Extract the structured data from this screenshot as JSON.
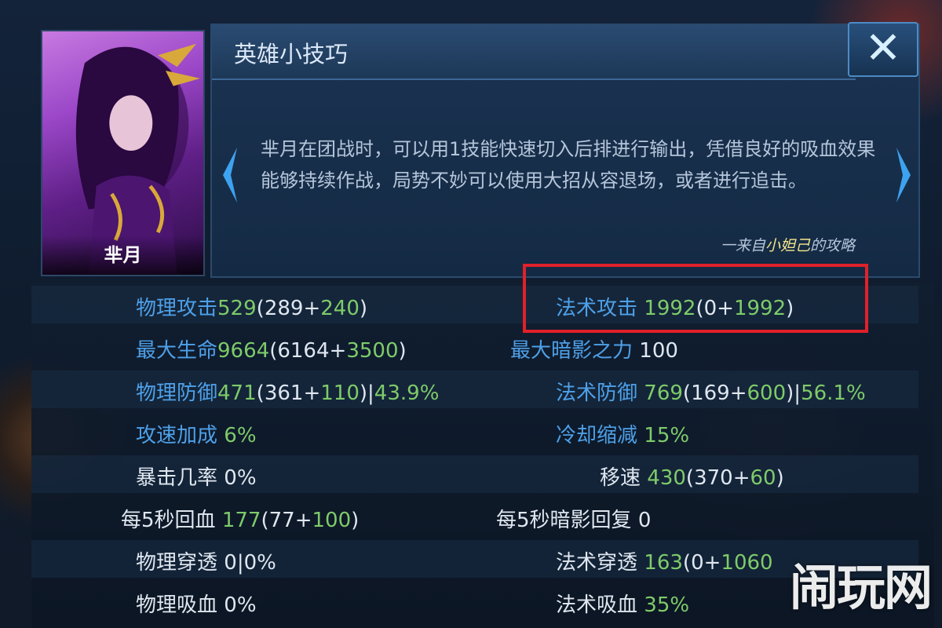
{
  "hero": {
    "name": "芈月"
  },
  "tip": {
    "title": "英雄小技巧",
    "body": "芈月在团战时，可以用1技能快速切入后排进行输出，凭借良好的吸血效果能够持续作战，局势不妙可以使用大招从容退场，或者进行追击。",
    "source_prefix": "一来自",
    "source_author": "小妲己",
    "source_suffix": "的攻略"
  },
  "close_symbol": "✕",
  "stats_left": [
    {
      "label": "物理攻击",
      "total": "529",
      "base": "289",
      "bonus": "240",
      "extra": ""
    },
    {
      "label": "最大生命",
      "total": "9664",
      "base": "6164",
      "bonus": "3500",
      "extra": ""
    },
    {
      "label": "物理防御",
      "total": "471",
      "base": "361",
      "bonus": "110",
      "extra": "43.9%"
    },
    {
      "label": "攻速加成",
      "total": "6%"
    },
    {
      "label": "暴击几率",
      "total": "0%"
    },
    {
      "label": "每5秒回血",
      "total": "177",
      "base": "77",
      "bonus": "100"
    },
    {
      "label": "物理穿透",
      "total": "0|0%"
    },
    {
      "label": "物理吸血",
      "total": "0%"
    }
  ],
  "stats_right": [
    {
      "label": "法术攻击",
      "total": "1992",
      "base": "0",
      "bonus": "1992"
    },
    {
      "label": "最大暗影之力",
      "total": "100"
    },
    {
      "label": "法术防御",
      "total": "769",
      "base": "169",
      "bonus": "600",
      "extra": "56.1%"
    },
    {
      "label": "冷却缩减",
      "total": "15%"
    },
    {
      "label": "移速",
      "total": "430",
      "base": "370",
      "bonus": "60"
    },
    {
      "label": "每5秒暗影回复",
      "total": "0"
    },
    {
      "label": "法术穿透",
      "total": "163",
      "base": "0",
      "bonus": "1060"
    },
    {
      "label": "法术吸血",
      "total": "35%"
    }
  ],
  "watermark": "闹玩网",
  "colors": {
    "label_blue": "#4ea0e8",
    "value_green": "#7ecb6a",
    "highlight_red": "#e0212a"
  }
}
